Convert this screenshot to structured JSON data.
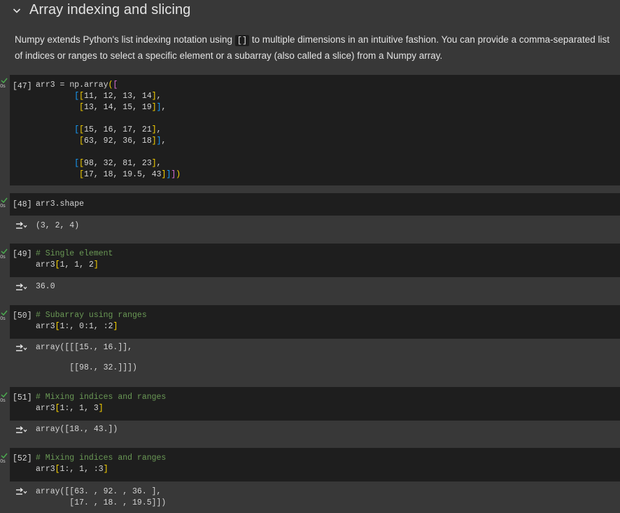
{
  "section": {
    "title": "Array indexing and slicing",
    "paragraph_before": "Numpy extends Python's list indexing notation using ",
    "inline_code": "[]",
    "paragraph_after": " to multiple dimensions in an intuitive fashion. You can provide a comma-separated list of indices or ranges to select a specific element or a subarray (also called a slice) from a Numpy array."
  },
  "cells": [
    {
      "count": "[47]",
      "time": "0s",
      "code_lines": [
        "arr3 = np.array([",
        "[[11, 12, 13, 14],",
        " [13, 14, 15, 19]],",
        "",
        "[[15, 16, 17, 21],",
        " [63, 92, 36, 18]],",
        "",
        "[[98, 32, 81, 23],",
        " [17, 18, 19.5, 43]]])"
      ],
      "output": []
    },
    {
      "count": "[48]",
      "time": "0s",
      "code_lines": [
        "arr3.shape"
      ],
      "output": [
        "(3, 2, 4)"
      ]
    },
    {
      "count": "[49]",
      "time": "0s",
      "code_lines": [
        "# Single element",
        "arr3[1, 1, 2]"
      ],
      "output": [
        "36.0"
      ]
    },
    {
      "count": "[50]",
      "time": "0s",
      "code_lines": [
        "# Subarray using ranges",
        "arr3[1:, 0:1, :2]"
      ],
      "output": [
        "array([[[15., 16.]],",
        "",
        "       [[98., 32.]]])"
      ]
    },
    {
      "count": "[51]",
      "time": "0s",
      "code_lines": [
        "# Mixing indices and ranges",
        "arr3[1:, 1, 3]"
      ],
      "output": [
        "array([18., 43.])"
      ]
    },
    {
      "count": "[52]",
      "time": "0s",
      "code_lines": [
        "# Mixing indices and ranges",
        "arr3[1:, 1, :3]"
      ],
      "output": [
        "array([[63. , 92. , 36. ],",
        "       [17. , 18. , 19.5]])"
      ]
    }
  ],
  "icons": {
    "collapse": "chevron-down-icon",
    "status": "check-icon",
    "output": "output-toggle-icon"
  },
  "colors": {
    "background": "#383838",
    "code_background": "#1e1e1e",
    "check": "#4caf50",
    "comment": "#6a9955"
  }
}
